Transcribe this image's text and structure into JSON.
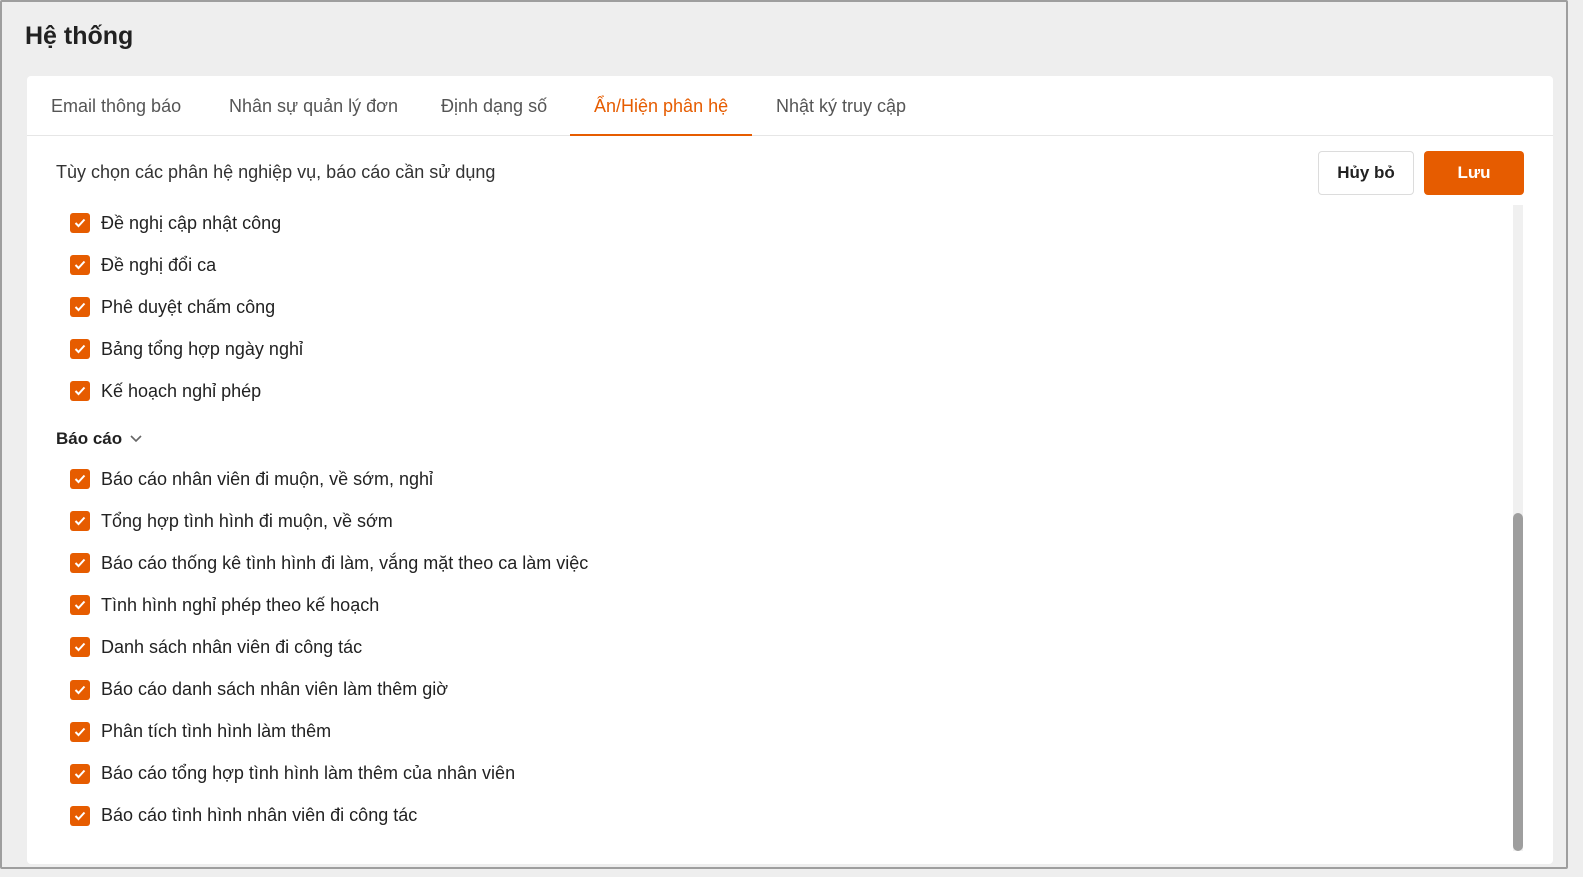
{
  "title": "Hệ thống",
  "tabs": [
    {
      "label": "Email thông báo"
    },
    {
      "label": "Nhân sự quản lý đơn"
    },
    {
      "label": "Định dạng số"
    },
    {
      "label": "Ẩn/Hiện phân hệ",
      "active": true
    },
    {
      "label": "Nhật ký truy cập"
    }
  ],
  "description": "Tùy chọn các phân hệ nghiệp vụ, báo cáo cần sử dụng",
  "buttons": {
    "cancel": "Hủy bỏ",
    "save": "Lưu"
  },
  "colors": {
    "accent": "#e65c00"
  },
  "modules": [
    {
      "label": "Đề nghị cập nhật công",
      "checked": true
    },
    {
      "label": "Đề nghị đổi ca",
      "checked": true
    },
    {
      "label": "Phê duyệt chấm công",
      "checked": true
    },
    {
      "label": "Bảng tổng hợp ngày nghỉ",
      "checked": true
    },
    {
      "label": "Kế hoạch nghỉ phép",
      "checked": true
    }
  ],
  "reports_section": {
    "label": "Báo cáo",
    "expanded": true
  },
  "reports": [
    {
      "label": "Báo cáo nhân viên đi muộn, về sớm, nghỉ",
      "checked": true
    },
    {
      "label": "Tổng hợp tình hình đi muộn, về sớm",
      "checked": true
    },
    {
      "label": "Báo cáo thống kê tình hình đi làm, vắng mặt theo ca làm việc",
      "checked": true
    },
    {
      "label": "Tình hình nghỉ phép theo kế hoạch",
      "checked": true
    },
    {
      "label": "Danh sách nhân viên đi công tác",
      "checked": true
    },
    {
      "label": "Báo cáo danh sách nhân viên làm thêm giờ",
      "checked": true
    },
    {
      "label": "Phân tích tình hình làm thêm",
      "checked": true
    },
    {
      "label": "Báo cáo tổng hợp tình hình làm thêm của nhân viên",
      "checked": true
    },
    {
      "label": "Báo cáo tình hình nhân viên đi công tác",
      "checked": true
    }
  ]
}
